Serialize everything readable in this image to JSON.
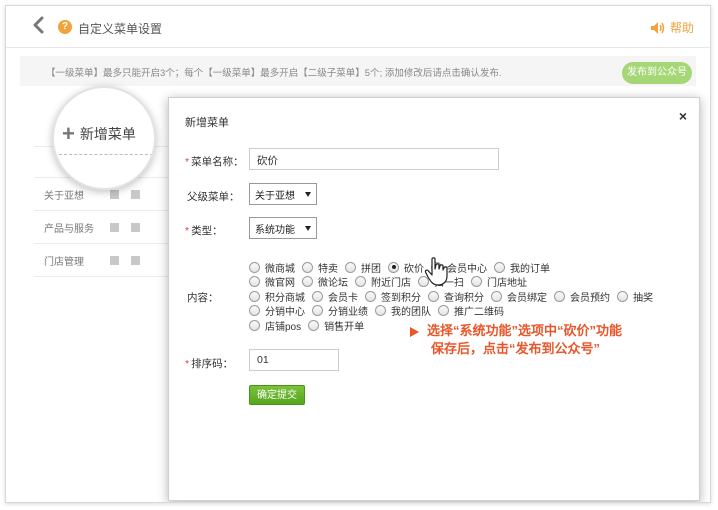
{
  "header": {
    "title": "自定义菜单设置",
    "help_label": "帮助"
  },
  "notice": {
    "text": "【一级菜单】最多只能开启3个；每个【一级菜单】最多开启【二级子菜单】5个; 添加修改后请点击确认发布.",
    "publish_label": "发布到公众号"
  },
  "menu_list": {
    "add_label": "新增菜单",
    "items": [
      "关于亚想",
      "产品与服务",
      "门店管理"
    ]
  },
  "modal": {
    "title": "新增菜单",
    "close_label": "×",
    "name_label": "菜单名称：",
    "name_value": "砍价",
    "parent_label": "父级菜单：",
    "parent_value": "关于亚想",
    "type_label": "类型：",
    "type_value": "系统功能",
    "content_label": "内容：",
    "content_rows": [
      [
        {
          "label": "微商城",
          "checked": false
        },
        {
          "label": "特卖",
          "checked": false
        },
        {
          "label": "拼团",
          "checked": false
        },
        {
          "label": "砍价",
          "checked": true
        },
        {
          "label": "会员中心",
          "checked": false
        },
        {
          "label": "我的订单",
          "checked": false
        }
      ],
      [
        {
          "label": "微官网",
          "checked": false
        },
        {
          "label": "微论坛",
          "checked": false
        },
        {
          "label": "附近门店",
          "checked": false
        },
        {
          "label": "扫一扫",
          "checked": false
        },
        {
          "label": "门店地址",
          "checked": false
        }
      ],
      [
        {
          "label": "积分商城",
          "checked": false
        },
        {
          "label": "会员卡",
          "checked": false
        },
        {
          "label": "签到积分",
          "checked": false
        },
        {
          "label": "查询积分",
          "checked": false
        },
        {
          "label": "会员绑定",
          "checked": false
        },
        {
          "label": "会员预约",
          "checked": false
        },
        {
          "label": "抽奖",
          "checked": false
        }
      ],
      [
        {
          "label": "分销中心",
          "checked": false
        },
        {
          "label": "分销业绩",
          "checked": false
        },
        {
          "label": "我的团队",
          "checked": false
        },
        {
          "label": "推广二维码",
          "checked": false
        }
      ],
      [
        {
          "label": "店铺pos",
          "checked": false
        },
        {
          "label": "销售开单",
          "checked": false
        }
      ]
    ],
    "sort_label": "排序码：",
    "sort_value": "01",
    "submit_label": "确定提交"
  },
  "annotation": {
    "line1": "选择“系统功能”选项中“砍价”功能",
    "line2": "保存后，点击“发布到公众号”"
  },
  "colors": {
    "accent_orange": "#f0a33a",
    "publish_green": "#a6d776",
    "submit_green": "#5aaa1f",
    "annotation_red": "#e8562a"
  }
}
